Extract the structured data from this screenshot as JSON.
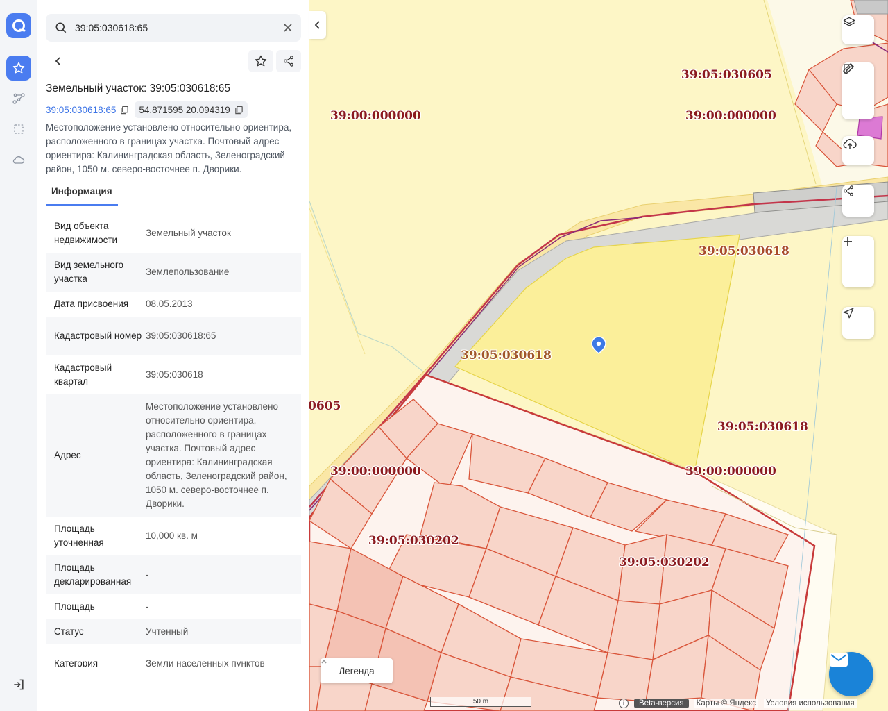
{
  "search": {
    "value": "39:05:030618:65"
  },
  "title": "Земельный участок: 39:05:030618:65",
  "cadastral_link": "39:05:030618:65",
  "coordinates": "54.871595 20.094319",
  "description": "Местоположение установлено относительно ориентира, расположенного в границах участка. Почтовый адрес ориентира: Калининградская область, Зеленоградский район, 1050 м. северо-восточнее п. Дворики.",
  "tab": "Информация",
  "rows": [
    {
      "k": "Вид объекта недвижимости",
      "v": "Земельный участок"
    },
    {
      "k": "Вид земельного участка",
      "v": "Землепользование"
    },
    {
      "k": "Дата присвоения",
      "v": "08.05.2013"
    },
    {
      "k": "Кадастровый номер",
      "v": "39:05:030618:65"
    },
    {
      "k": "Кадастровый квартал",
      "v": "39:05:030618"
    },
    {
      "k": "Адрес",
      "v": "Местоположение установлено относительно ориентира, расположенного в границах участка. Почтовый адрес ориентира: Калининградская область, Зеленоградский район, 1050 м. северо-восточнее п. Дворики."
    },
    {
      "k": "Площадь уточненная",
      "v": "10,000 кв. м"
    },
    {
      "k": "Площадь декларированная",
      "v": "-"
    },
    {
      "k": "Площадь",
      "v": "-"
    },
    {
      "k": "Статус",
      "v": "Учтенный"
    },
    {
      "k": "Категория",
      "v": "Земли населенных пунктов"
    }
  ],
  "map_labels": {
    "l1": "39:05:030605",
    "l2": "39:00:000000",
    "l3": "39:00:000000",
    "l4": "39:05:030618",
    "l5": "39:05:030618",
    "l6": "0605",
    "l7": "39:05:030618",
    "l8": "39:00:000000",
    "l9": "39:00:000000",
    "l10": "39:05:030202",
    "l11": "39:05:030202"
  },
  "legend_label": "Легенда",
  "scale_label": "50 m",
  "attribution": {
    "beta": "Beta-версия",
    "maps": "Карты © Яндекс",
    "terms": "Условия использования"
  },
  "icons": {
    "logo": "app-logo-icon",
    "favorites": "star-icon",
    "routes": "route-icon",
    "select": "selection-icon",
    "cloud": "cloud-icon",
    "logout": "logout-icon"
  },
  "colors": {
    "accent": "#4a7cf0",
    "parcel_fill": "#fbef9a",
    "label": "#8b1a1f",
    "block_fill": "#f8d5c9",
    "block_stroke": "#d9553a"
  }
}
